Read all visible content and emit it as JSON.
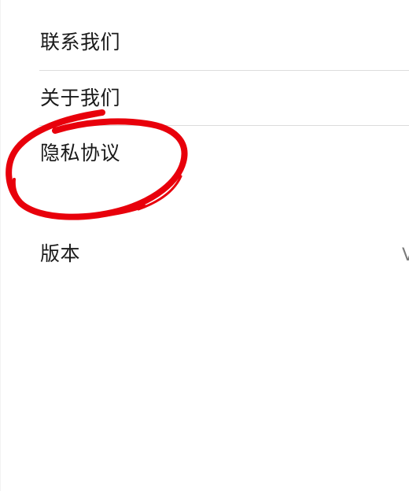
{
  "menu": {
    "items": [
      {
        "label": "联系我们"
      },
      {
        "label": "关于我们"
      },
      {
        "label": "隐私协议"
      },
      {
        "label": "版本",
        "value": "V"
      }
    ]
  },
  "annotation": {
    "type": "hand-drawn-circle",
    "target": "隐私协议",
    "color": "#e8000b"
  }
}
